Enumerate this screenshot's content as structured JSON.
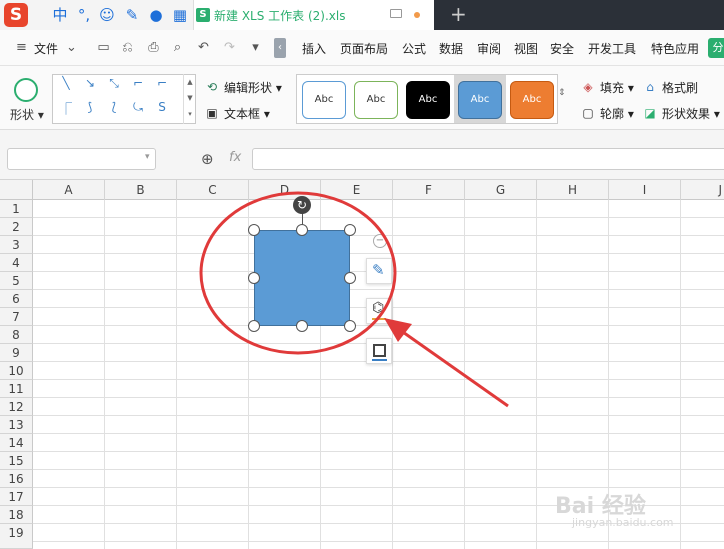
{
  "ime": {
    "logo": "S",
    "mode": "中",
    "punct": "°,",
    "emoji": "☺"
  },
  "tab": {
    "badge": "S",
    "title": "新建 XLS 工作表 (2).xls"
  },
  "menubar": {
    "file": "文件",
    "items": [
      "插入",
      "页面布局",
      "公式",
      "数据",
      "审阅",
      "视图",
      "安全",
      "开发工具",
      "特色应用"
    ],
    "special": "分"
  },
  "ribbon": {
    "shape_label": "形状",
    "edit_shape": "编辑形状",
    "textbox": "文本框",
    "style_labels": [
      "Abc",
      "Abc",
      "Abc",
      "Abc",
      "Abc"
    ],
    "fill": "填充",
    "format_painter": "格式刷",
    "outline": "轮廓",
    "shape_effect": "形状效果"
  },
  "formula": {
    "fx": "fx",
    "namebox": "",
    "content": ""
  },
  "columns": [
    "A",
    "B",
    "C",
    "D",
    "E",
    "F",
    "G",
    "H",
    "I",
    "J"
  ],
  "rows": [
    "1",
    "2",
    "3",
    "4",
    "5",
    "6",
    "7",
    "8",
    "9",
    "10",
    "11",
    "12",
    "13",
    "14",
    "15",
    "16",
    "17",
    "18",
    "19"
  ],
  "watermark": {
    "main": "Bai 经验",
    "sub": "jingyan.baidu.com"
  },
  "colors": {
    "shape_fill": "#5b9bd5",
    "annotation": "#e03a3a",
    "accent": "#2bae6f"
  }
}
